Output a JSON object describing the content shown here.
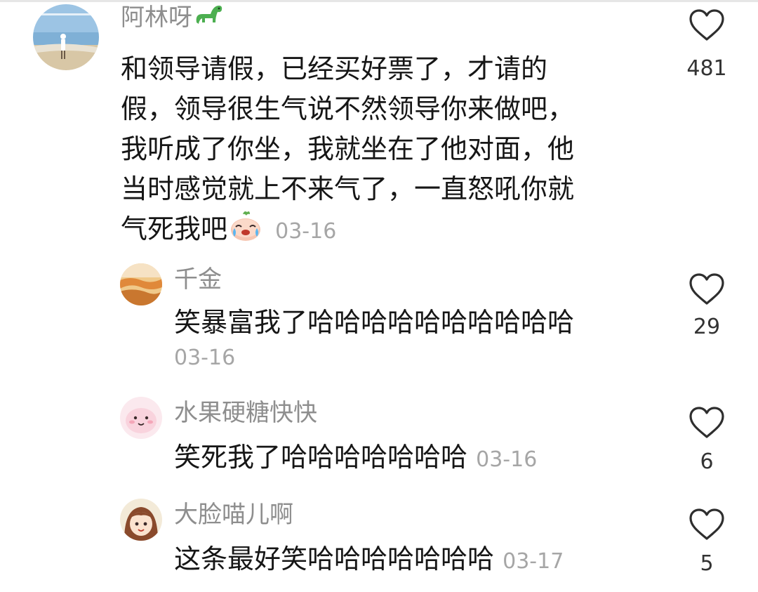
{
  "comments": [
    {
      "username": "阿林呀",
      "username_emoji": "dinosaur-emoji",
      "text_lines": [
        "和领导请假，已经买好票了，才请的",
        "假，领导很生气说不然领导你来做吧，",
        "我听成了你坐，我就坐在了他对面，他",
        "当时感觉就上不来气了，一直怒吼你就",
        "气死我吧"
      ],
      "trailing_emoji": "crying-laugh-emoji",
      "time": "03-16",
      "likes": "481",
      "avatar": "beach-photo-avatar"
    }
  ],
  "replies": [
    {
      "username": "千金",
      "text": "笑暴富我了哈哈哈哈哈哈哈哈哈哈",
      "time": "03-16",
      "likes": "29",
      "avatar": "orange-sea-avatar"
    },
    {
      "username": "水果硬糖快快",
      "text": "笑死我了哈哈哈哈哈哈哈",
      "time": "03-16",
      "likes": "6",
      "avatar": "pink-blob-avatar"
    },
    {
      "username": "大脸喵儿啊",
      "text": "这条最好笑哈哈哈哈哈哈哈",
      "time": "03-17",
      "likes": "5",
      "avatar": "anime-girl-avatar"
    }
  ],
  "colors": {
    "username": "#8e8e8e",
    "text": "#161616",
    "time": "#a6a6a6",
    "heart_stroke": "#2e2e2e"
  },
  "icons": {
    "like": "heart-outline-icon"
  }
}
